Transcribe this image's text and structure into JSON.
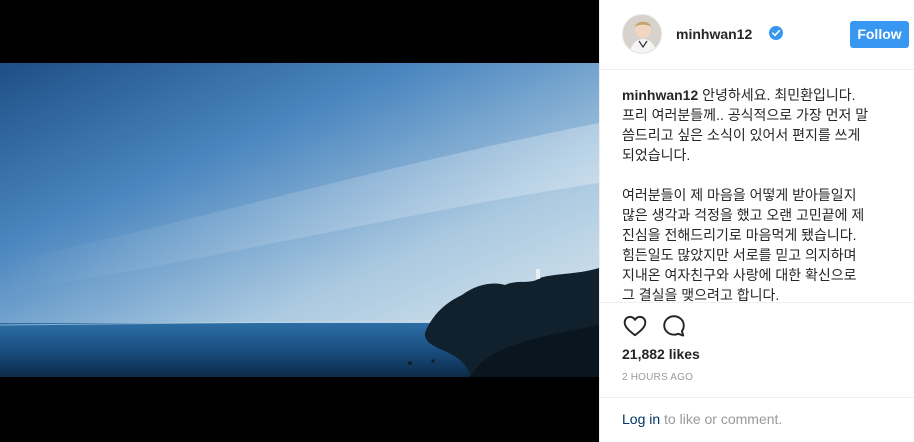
{
  "post": {
    "username": "minhwan12",
    "follow_label": "Follow",
    "caption_user": "minhwan12",
    "caption_lines": [
      " 안녕하세요. 최민환입니다.",
      "프리 여러분들께.. 공식적으로 가장 먼저 말",
      "씀드리고 싶은 소식이 있어서 편지를 쓰게",
      "되었습니다.",
      "",
      "여러분들이 제 마음을 어떻게 받아들일지",
      "많은 생각과 걱정을 했고 오랜 고민끝에 제",
      "진심을 전해드리기로 마음먹게 됐습니다.",
      "힘든일도 많았지만 서로를 믿고 의지하며",
      "지내온 여자친구와 사랑에 대한 확신으로",
      "그 결실을 맺으려고 합니다."
    ],
    "likes": "21,882 likes",
    "timestamp": "2 HOURS AGO",
    "login_link": "Log in",
    "login_suffix": " to like or comment."
  },
  "icons": {
    "avatar": "avatar",
    "verified": "verified-badge-icon",
    "like": "heart-icon",
    "comment": "comment-icon"
  },
  "colors": {
    "follow_button": "#3897f0",
    "verified": "#3897f0",
    "link": "#003569",
    "muted": "#999999"
  }
}
